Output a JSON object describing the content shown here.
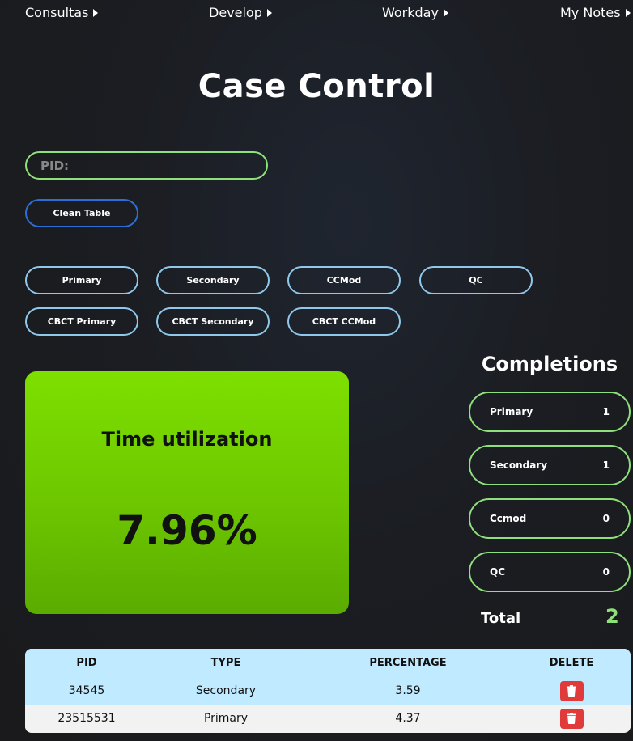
{
  "nav": {
    "items": [
      {
        "label": "Consultas"
      },
      {
        "label": "Develop"
      },
      {
        "label": "Workday"
      },
      {
        "label": "My Notes"
      }
    ]
  },
  "page_title": "Case Control",
  "pid_input": {
    "placeholder": "PID:",
    "value": ""
  },
  "clean_button": "Clean Table",
  "type_buttons": [
    "Primary",
    "Secondary",
    "CCMod",
    "QC",
    "CBCT Primary",
    "CBCT Secondary",
    "CBCT CCMod"
  ],
  "time_utilization": {
    "label": "Time utilization",
    "value": "7.96%"
  },
  "completions": {
    "title": "Completions",
    "items": [
      {
        "label": "Primary",
        "count": "1"
      },
      {
        "label": "Secondary",
        "count": "1"
      },
      {
        "label": "Ccmod",
        "count": "0"
      },
      {
        "label": "QC",
        "count": "0"
      }
    ],
    "total_label": "Total",
    "total_value": "2"
  },
  "table": {
    "headers": [
      "PID",
      "TYPE",
      "PERCENTAGE",
      "DELETE"
    ],
    "rows": [
      {
        "pid": "34545",
        "type": "Secondary",
        "percentage": "3.59"
      },
      {
        "pid": "23515531",
        "type": "Primary",
        "percentage": "4.37"
      }
    ]
  },
  "colors": {
    "accent_green": "#8ee07a",
    "clean_border": "#2d6ed6",
    "type_border": "#8fc8ea",
    "card_green": "#7ee000",
    "delete_red": "#e03a3a",
    "table_header": "#bfeaff"
  },
  "icons": {
    "nav_arrow": "caret-right-icon",
    "delete": "trash-icon"
  }
}
